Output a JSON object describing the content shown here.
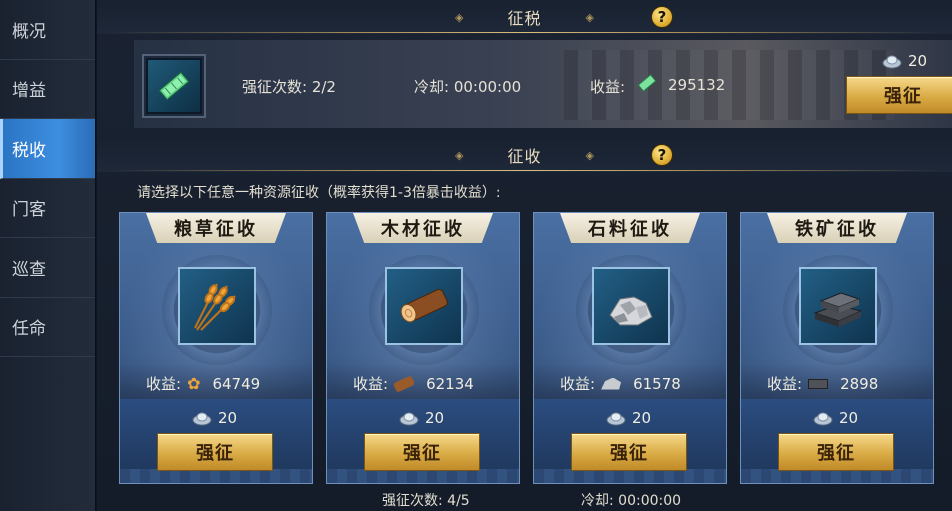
{
  "sidebar": {
    "items": [
      {
        "label": "概况"
      },
      {
        "label": "增益"
      },
      {
        "label": "税收"
      },
      {
        "label": "门客"
      },
      {
        "label": "巡查"
      },
      {
        "label": "任命"
      }
    ]
  },
  "tax_section": {
    "title": "征税",
    "force_count_label": "强征次数: 2/2",
    "cooldown_label": "冷却: 00:00:00",
    "income_label": "收益:",
    "income_value": "295132",
    "cost_value": "20",
    "button_label": "强征"
  },
  "collect_section": {
    "title": "征收",
    "instruction": "请选择以下任意一种资源征收（概率获得1-3倍暴击收益）:",
    "cards": [
      {
        "title": "粮草征收",
        "income_label": "收益:",
        "income_value": "64749",
        "cost": "20",
        "button_label": "强征"
      },
      {
        "title": "木材征收",
        "income_label": "收益:",
        "income_value": "62134",
        "cost": "20",
        "button_label": "强征"
      },
      {
        "title": "石料征收",
        "income_label": "收益:",
        "income_value": "61578",
        "cost": "20",
        "button_label": "强征"
      },
      {
        "title": "铁矿征收",
        "income_label": "收益:",
        "income_value": "2898",
        "cost": "20",
        "button_label": "强征"
      }
    ],
    "footer_count": "强征次数: 4/5",
    "footer_cooldown": "冷却: 00:00:00"
  },
  "icons": {
    "help": "?",
    "ornament": "◈"
  }
}
